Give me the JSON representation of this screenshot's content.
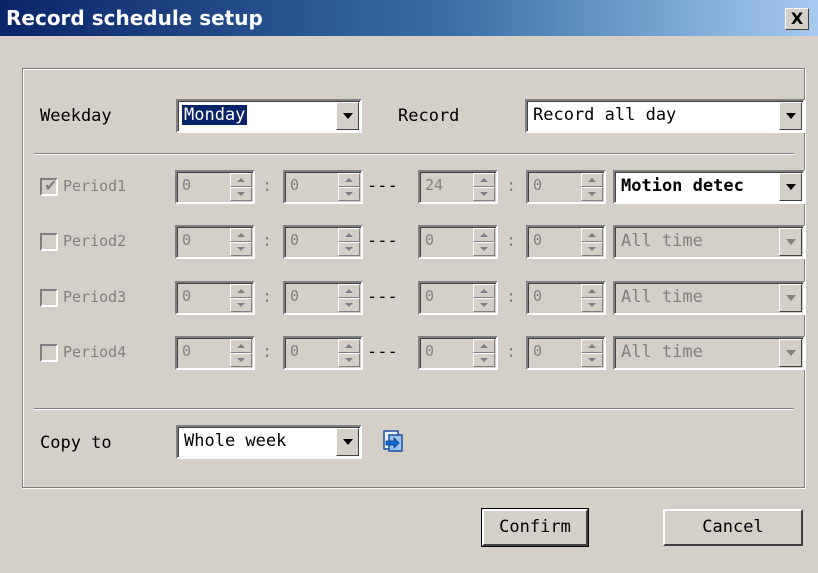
{
  "window": {
    "title": "Record schedule setup",
    "close_label": "X"
  },
  "weekday": {
    "label": "Weekday",
    "value": "Monday"
  },
  "record": {
    "label": "Record",
    "value": "Record all day"
  },
  "periods": [
    {
      "label": "Period1",
      "checked": true,
      "start_h": "0",
      "start_m": "0",
      "end_h": "24",
      "end_m": "0",
      "mode": "Motion detec",
      "mode_enabled": true
    },
    {
      "label": "Period2",
      "checked": false,
      "start_h": "0",
      "start_m": "0",
      "end_h": "0",
      "end_m": "0",
      "mode": "All time",
      "mode_enabled": false
    },
    {
      "label": "Period3",
      "checked": false,
      "start_h": "0",
      "start_m": "0",
      "end_h": "0",
      "end_m": "0",
      "mode": "All time",
      "mode_enabled": false
    },
    {
      "label": "Period4",
      "checked": false,
      "start_h": "0",
      "start_m": "0",
      "end_h": "0",
      "end_m": "0",
      "mode": "All time",
      "mode_enabled": false
    }
  ],
  "separators": {
    "colon": ":",
    "range": "---"
  },
  "copy_to": {
    "label": "Copy to",
    "value": "Whole week",
    "icon": "copy-apply-icon"
  },
  "buttons": {
    "confirm": "Confirm",
    "cancel": "Cancel"
  },
  "colors": {
    "title_bar": "#0a246a",
    "face": "#d4d0c8",
    "selection": "#0a246a"
  }
}
